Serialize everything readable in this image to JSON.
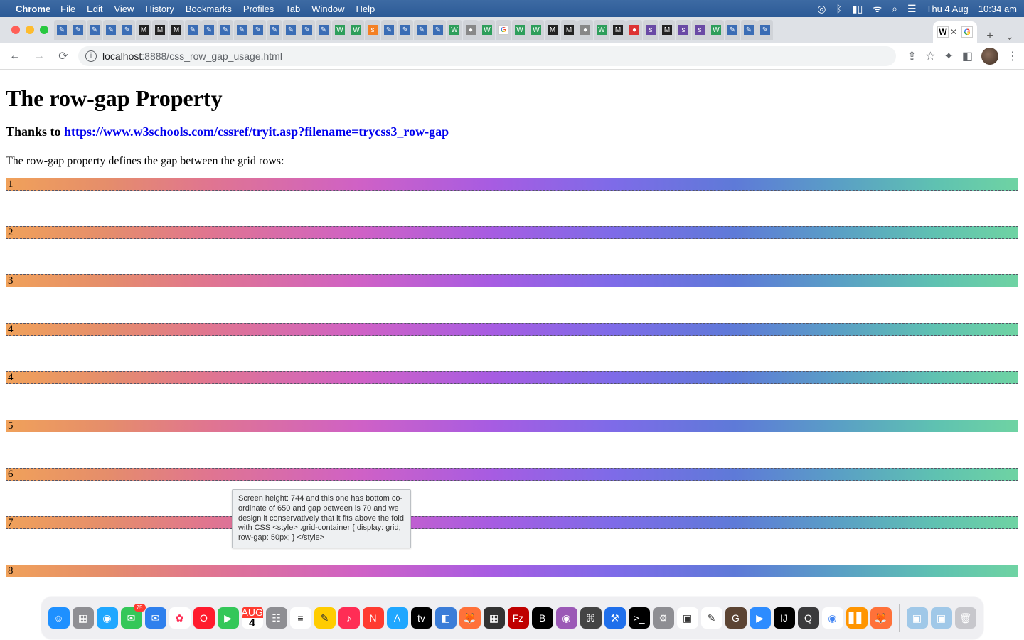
{
  "mac_menu": {
    "app_name": "Chrome",
    "items": [
      "File",
      "Edit",
      "View",
      "History",
      "Bookmarks",
      "Profiles",
      "Tab",
      "Window",
      "Help"
    ],
    "right": {
      "date": "Thu 4 Aug",
      "time": "10:34 am"
    }
  },
  "browser": {
    "url_display_host": "localhost",
    "url_display_port_path": ":8888/css_row_gap_usage.html",
    "active_tab_favicons": [
      "wiki",
      "google"
    ],
    "new_tab_label": "+",
    "background_tab_favicons": [
      "blue",
      "blue",
      "blue",
      "blue",
      "blue",
      "dark",
      "dark",
      "dark",
      "blue",
      "blue",
      "blue",
      "blue",
      "blue",
      "blue",
      "blue",
      "blue",
      "blue",
      "green",
      "green",
      "orange",
      "blue",
      "blue",
      "blue",
      "blue",
      "green",
      "grey",
      "green",
      "google",
      "green",
      "green",
      "dark",
      "dark",
      "grey",
      "green",
      "dark",
      "red",
      "purple",
      "dark",
      "purple",
      "purple",
      "green",
      "blue",
      "blue",
      "blue"
    ]
  },
  "page": {
    "h1": "The row-gap Property",
    "thanks_prefix": "Thanks to ",
    "thanks_link_text": "https://www.w3schools.com/cssref/tryit.asp?filename=trycss3_row-gap",
    "lead": "The row-gap property defines the gap between the grid rows:",
    "rows": [
      "1",
      "2",
      "3",
      "4",
      "4",
      "5",
      "6",
      "7",
      "8"
    ],
    "tooltip": "Screen height: 744 and this one has bottom co-ordinate of 650 and gap between is 70 and we design it conservatively that it fits above the fold with CSS <style>  .grid-container { display: grid; row-gap: 50px; } </style>"
  },
  "dock": {
    "calendar_month_label": "AUG",
    "calendar_day": "4",
    "messages_badge": "75",
    "apps": [
      {
        "name": "finder",
        "bg": "#1e90ff",
        "glyph": "☺"
      },
      {
        "name": "launchpad",
        "bg": "#8e8e93",
        "glyph": "▦"
      },
      {
        "name": "safari",
        "bg": "#1fa7ff",
        "glyph": "◉"
      },
      {
        "name": "messages",
        "bg": "#34c759",
        "glyph": "✉",
        "badge": true
      },
      {
        "name": "mail",
        "bg": "#2f80ed",
        "glyph": "✉"
      },
      {
        "name": "photos",
        "bg": "#ffffff",
        "glyph": "✿",
        "fg": "#ff2d55"
      },
      {
        "name": "opera",
        "bg": "#ff1b2d",
        "glyph": "O"
      },
      {
        "name": "facetime",
        "bg": "#34c759",
        "glyph": "▶"
      },
      {
        "name": "calendar",
        "bg": "#ffffff",
        "glyph": "",
        "calendar": true
      },
      {
        "name": "contacts",
        "bg": "#8e8e93",
        "glyph": "☷"
      },
      {
        "name": "reminders",
        "bg": "#ffffff",
        "glyph": "≡",
        "fg": "#333"
      },
      {
        "name": "notes",
        "bg": "#ffcc00",
        "glyph": "✎",
        "fg": "#333"
      },
      {
        "name": "music",
        "bg": "#ff2d55",
        "glyph": "♪"
      },
      {
        "name": "news",
        "bg": "#ff3b30",
        "glyph": "N"
      },
      {
        "name": "appstore",
        "bg": "#1fa7ff",
        "glyph": "A"
      },
      {
        "name": "appletv",
        "bg": "#000",
        "glyph": "tv"
      },
      {
        "name": "preview",
        "bg": "#3b7dd8",
        "glyph": "◧"
      },
      {
        "name": "firefox",
        "bg": "#ff7139",
        "glyph": "🦊"
      },
      {
        "name": "calculator",
        "bg": "#333",
        "glyph": "▦"
      },
      {
        "name": "filezilla",
        "bg": "#bf0000",
        "glyph": "Fz"
      },
      {
        "name": "bold-b",
        "bg": "#000",
        "glyph": "B"
      },
      {
        "name": "podcasts",
        "bg": "#9b59b6",
        "glyph": "◉"
      },
      {
        "name": "dev",
        "bg": "#444",
        "glyph": "⌘"
      },
      {
        "name": "xcode",
        "bg": "#1f6feb",
        "glyph": "⚒"
      },
      {
        "name": "terminal",
        "bg": "#000",
        "glyph": ">_"
      },
      {
        "name": "settings",
        "bg": "#8e8e93",
        "glyph": "⚙"
      },
      {
        "name": "vm",
        "bg": "#ffffff",
        "glyph": "▣",
        "fg": "#333"
      },
      {
        "name": "textedit",
        "bg": "#ffffff",
        "glyph": "✎",
        "fg": "#333"
      },
      {
        "name": "gimp",
        "bg": "#5c4433",
        "glyph": "G"
      },
      {
        "name": "zoom",
        "bg": "#2d8cff",
        "glyph": "▶"
      },
      {
        "name": "intellij",
        "bg": "#000",
        "glyph": "IJ"
      },
      {
        "name": "quicktime",
        "bg": "#3a3a3c",
        "glyph": "Q"
      },
      {
        "name": "chrome",
        "bg": "#ffffff",
        "glyph": "◉",
        "fg": "#4285f4"
      },
      {
        "name": "books",
        "bg": "#ff9500",
        "glyph": "▋▋"
      },
      {
        "name": "firefox-dev",
        "bg": "#ff7139",
        "glyph": "🦊"
      },
      {
        "name": "folder",
        "bg": "#a0c8e8",
        "glyph": "▣"
      },
      {
        "name": "folder2",
        "bg": "#a0c8e8",
        "glyph": "▣"
      },
      {
        "name": "trash",
        "bg": "#c7c7cc",
        "glyph": "🗑"
      }
    ]
  }
}
